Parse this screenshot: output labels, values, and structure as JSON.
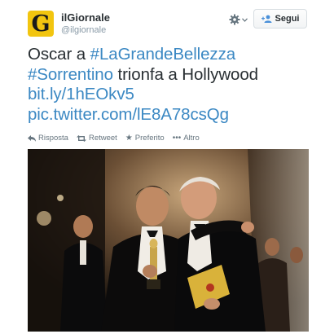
{
  "header": {
    "avatar_letter": "G",
    "user_name": "ilGiornale",
    "user_handle": "@ilgiornale",
    "gear_icon": "gear-icon",
    "follow_label": "Segui",
    "follow_icon": "follow-person-icon"
  },
  "tweet": {
    "line1_prefix": "Oscar a ",
    "hashtag1": "#LaGrandeBellezza",
    "hashtag2": "#Sorrentino",
    "line2_suffix": " trionfa a Hollywood",
    "link1": "bit.ly/1hEOkv5",
    "link2": "pic.twitter.com/lE8A78csQg"
  },
  "actions": {
    "reply": {
      "icon": "reply-icon",
      "label": "Risposta"
    },
    "retweet": {
      "icon": "retweet-icon",
      "label": "Retweet"
    },
    "favorite": {
      "icon": "star-icon",
      "label": "Preferito"
    },
    "more": {
      "icon": "more-dots-icon",
      "label": "Altro"
    }
  },
  "colors": {
    "link": "#3b88c3",
    "text": "#292f33",
    "muted": "#8899a6",
    "avatar_bg": "#f2c50f"
  }
}
